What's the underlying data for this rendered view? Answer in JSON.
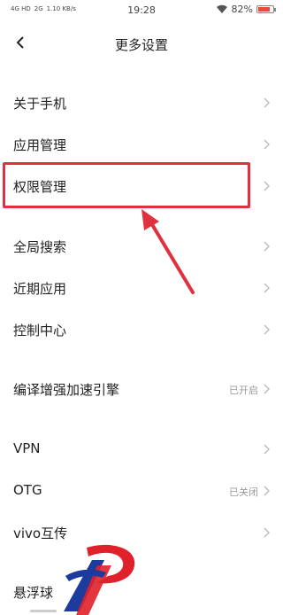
{
  "status_bar": {
    "signal_left": "4G HD",
    "signal_mid": "2G",
    "speed": "1.10 KB/s",
    "time": "19:28",
    "battery": "82%",
    "battery_level": 0.82
  },
  "header": {
    "title": "更多设置"
  },
  "items": [
    {
      "label": "关于手机",
      "status": ""
    },
    {
      "label": "应用管理",
      "status": ""
    },
    {
      "label": "权限管理",
      "status": ""
    },
    {
      "label": "全局搜索",
      "status": ""
    },
    {
      "label": "近期应用",
      "status": ""
    },
    {
      "label": "控制中心",
      "status": ""
    },
    {
      "label": "编译增强加速引擎",
      "status": "已开启"
    },
    {
      "label": "VPN",
      "status": ""
    },
    {
      "label": "OTG",
      "status": "已关闭"
    },
    {
      "label": "vivo互传",
      "status": ""
    },
    {
      "label": "悬浮球",
      "status": ""
    }
  ],
  "colors": {
    "highlight": "#e0313f",
    "arrow": "#e0313f",
    "logo_red": "#e0202a",
    "logo_blue": "#1d3b9c"
  }
}
